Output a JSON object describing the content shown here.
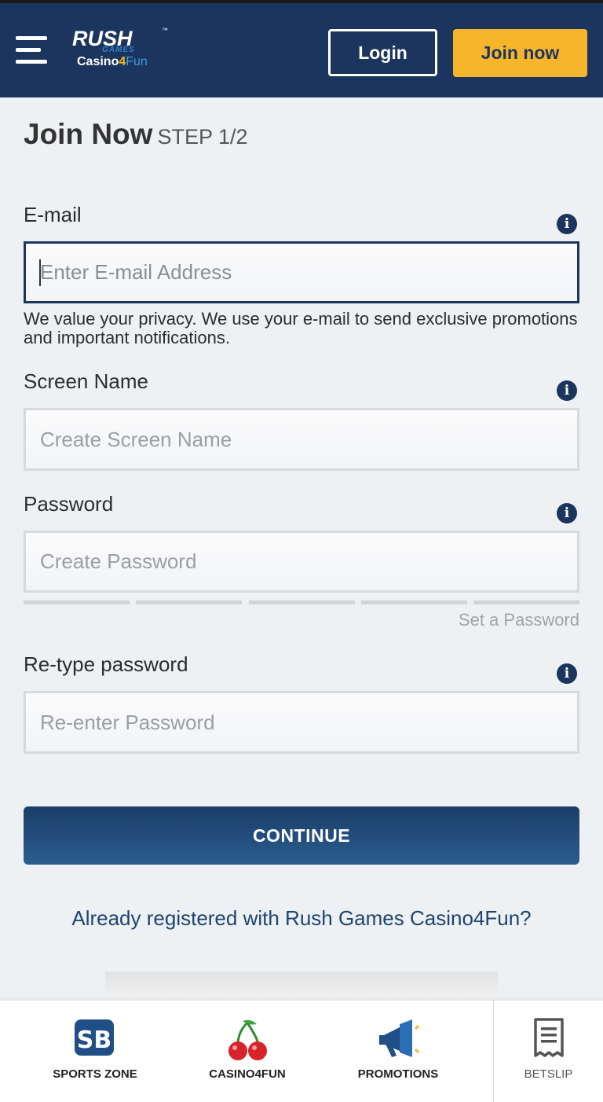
{
  "header": {
    "logo": {
      "main": "RUSH",
      "tm": "™",
      "sub": "GAMES",
      "bottom_a": "Casino",
      "bottom_b": "4",
      "bottom_c": "Fun"
    },
    "login_label": "Login",
    "join_label": "Join now",
    "menu_icon": "hamburger-icon"
  },
  "page": {
    "title": "Join Now",
    "step": "STEP 1/2"
  },
  "form": {
    "email": {
      "label": "E-mail",
      "placeholder": "Enter E-mail Address",
      "value": "",
      "help": "We value your privacy. We use your e-mail to send exclusive promotions and important notifications.",
      "info_icon": "info-icon"
    },
    "screen_name": {
      "label": "Screen Name",
      "placeholder": "Create Screen Name",
      "value": ""
    },
    "password": {
      "label": "Password",
      "placeholder": "Create Password",
      "value": "",
      "strength_text": "Set a Password",
      "strength_level": 0
    },
    "retype_password": {
      "label": "Re-type password",
      "placeholder": "Re-enter Password",
      "value": ""
    },
    "continue_label": "CONTINUE",
    "already_registered": "Already registered with Rush Games Casino4Fun?"
  },
  "bottom_nav": {
    "items": [
      {
        "label": "SPORTS ZONE",
        "icon": "sb-icon"
      },
      {
        "label": "CASINO4FUN",
        "icon": "cherries-icon"
      },
      {
        "label": "PROMOTIONS",
        "icon": "megaphone-icon"
      },
      {
        "label": "BETSLIP",
        "icon": "receipt-icon"
      }
    ]
  },
  "colors": {
    "header_bg": "#1c355e",
    "accent_yellow": "#f7b52c",
    "button_blue": "#1c3d68",
    "link_blue": "#1f4470"
  }
}
